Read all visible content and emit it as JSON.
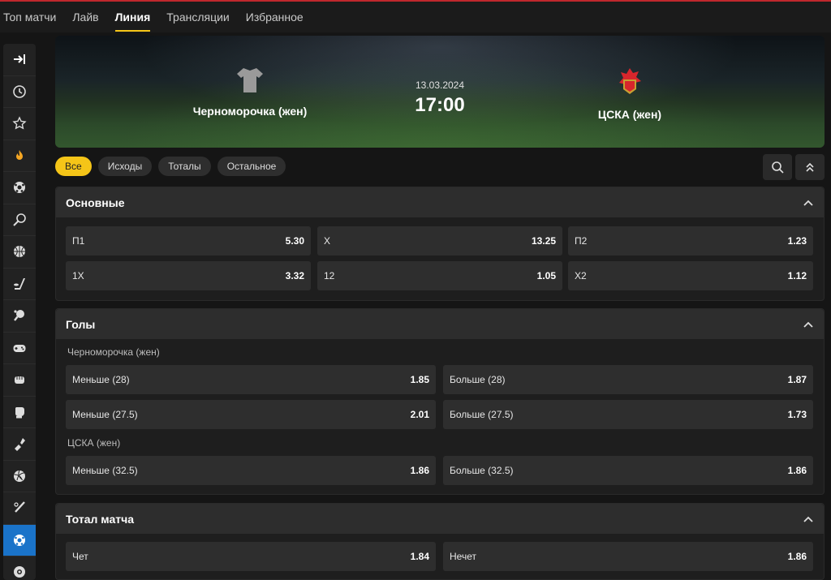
{
  "nav": {
    "tabs": [
      "Топ матчи",
      "Лайв",
      "Линия",
      "Трансляции",
      "Избранное"
    ],
    "active": "Линия"
  },
  "sidebar": {
    "icons": [
      "collapse-icon",
      "clock-icon",
      "star-icon",
      "fire-icon",
      "soccer-ball-icon",
      "tennis-icon",
      "basketball-icon",
      "hockey-icon",
      "table-tennis-icon",
      "gamepad-icon",
      "fist-icon",
      "boxing-glove-icon",
      "hands-icon",
      "volleyball-icon",
      "baseball-icon",
      "football-icon",
      "billiards-icon"
    ],
    "active_index": 15
  },
  "match": {
    "home": "Черноморочка (жен)",
    "away": "ЦСКА (жен)",
    "date": "13.03.2024",
    "time": "17:00"
  },
  "filters": {
    "chips": [
      "Все",
      "Исходы",
      "Тоталы",
      "Остальное"
    ],
    "active": "Все"
  },
  "sections": {
    "main": {
      "title": "Основные",
      "rows": [
        [
          {
            "label": "П1",
            "value": "5.30"
          },
          {
            "label": "X",
            "value": "13.25"
          },
          {
            "label": "П2",
            "value": "1.23"
          }
        ],
        [
          {
            "label": "1X",
            "value": "3.32"
          },
          {
            "label": "12",
            "value": "1.05"
          },
          {
            "label": "X2",
            "value": "1.12"
          }
        ]
      ]
    },
    "goals": {
      "title": "Голы",
      "home_label": "Черноморочка (жен)",
      "home_rows": [
        [
          {
            "label": "Меньше (28)",
            "value": "1.85"
          },
          {
            "label": "Больше (28)",
            "value": "1.87"
          }
        ],
        [
          {
            "label": "Меньше (27.5)",
            "value": "2.01"
          },
          {
            "label": "Больше (27.5)",
            "value": "1.73"
          }
        ]
      ],
      "away_label": "ЦСКА (жен)",
      "away_rows": [
        [
          {
            "label": "Меньше (32.5)",
            "value": "1.86"
          },
          {
            "label": "Больше (32.5)",
            "value": "1.86"
          }
        ]
      ]
    },
    "total": {
      "title": "Тотал матча",
      "rows": [
        [
          {
            "label": "Чет",
            "value": "1.84"
          },
          {
            "label": "Нечет",
            "value": "1.86"
          }
        ]
      ]
    }
  },
  "colors": {
    "accent": "#f5c518",
    "active_sidebar": "#1a73c9",
    "top_line": "#c0272d"
  }
}
